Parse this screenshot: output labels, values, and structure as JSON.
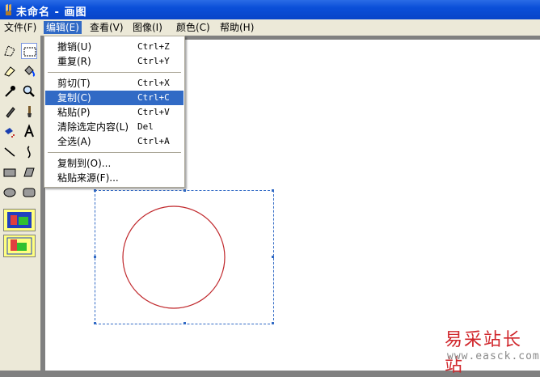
{
  "window": {
    "title": "未命名 - 画图"
  },
  "menubar": [
    {
      "label": "文件(F)"
    },
    {
      "label": "编辑(E)"
    },
    {
      "label": "查看(V)"
    },
    {
      "label": "图像(I)"
    },
    {
      "label": "颜色(C)"
    },
    {
      "label": "帮助(H)"
    }
  ],
  "edit_menu": {
    "items": [
      {
        "label": "撤销(U)",
        "shortcut": "Ctrl+Z"
      },
      {
        "label": "重复(R)",
        "shortcut": "Ctrl+Y"
      },
      {
        "label": "剪切(T)",
        "shortcut": "Ctrl+X"
      },
      {
        "label": "复制(C)",
        "shortcut": "Ctrl+C"
      },
      {
        "label": "粘贴(P)",
        "shortcut": "Ctrl+V"
      },
      {
        "label": "清除选定内容(L)",
        "shortcut": "Del"
      },
      {
        "label": "全选(A)",
        "shortcut": "Ctrl+A"
      },
      {
        "label": "复制到(O)...",
        "shortcut": ""
      },
      {
        "label": "粘贴来源(F)...",
        "shortcut": ""
      }
    ],
    "highlighted": "复制(C)"
  },
  "tools": [
    "free-select-icon",
    "rect-select-icon",
    "eraser-icon",
    "fill-icon",
    "color-picker-icon",
    "magnifier-icon",
    "pencil-icon",
    "brush-icon",
    "airbrush-icon",
    "text-icon",
    "line-icon",
    "curve-icon",
    "rectangle-icon",
    "polygon-icon",
    "ellipse-icon",
    "rounded-rect-icon"
  ],
  "colors": {
    "titlebar": "#0a4fd8",
    "menu_highlight": "#316ac5",
    "circle": "#c0282c",
    "selection": "#316ac5"
  },
  "watermark": {
    "text": "易采站长站",
    "url": "www.easck.com"
  }
}
